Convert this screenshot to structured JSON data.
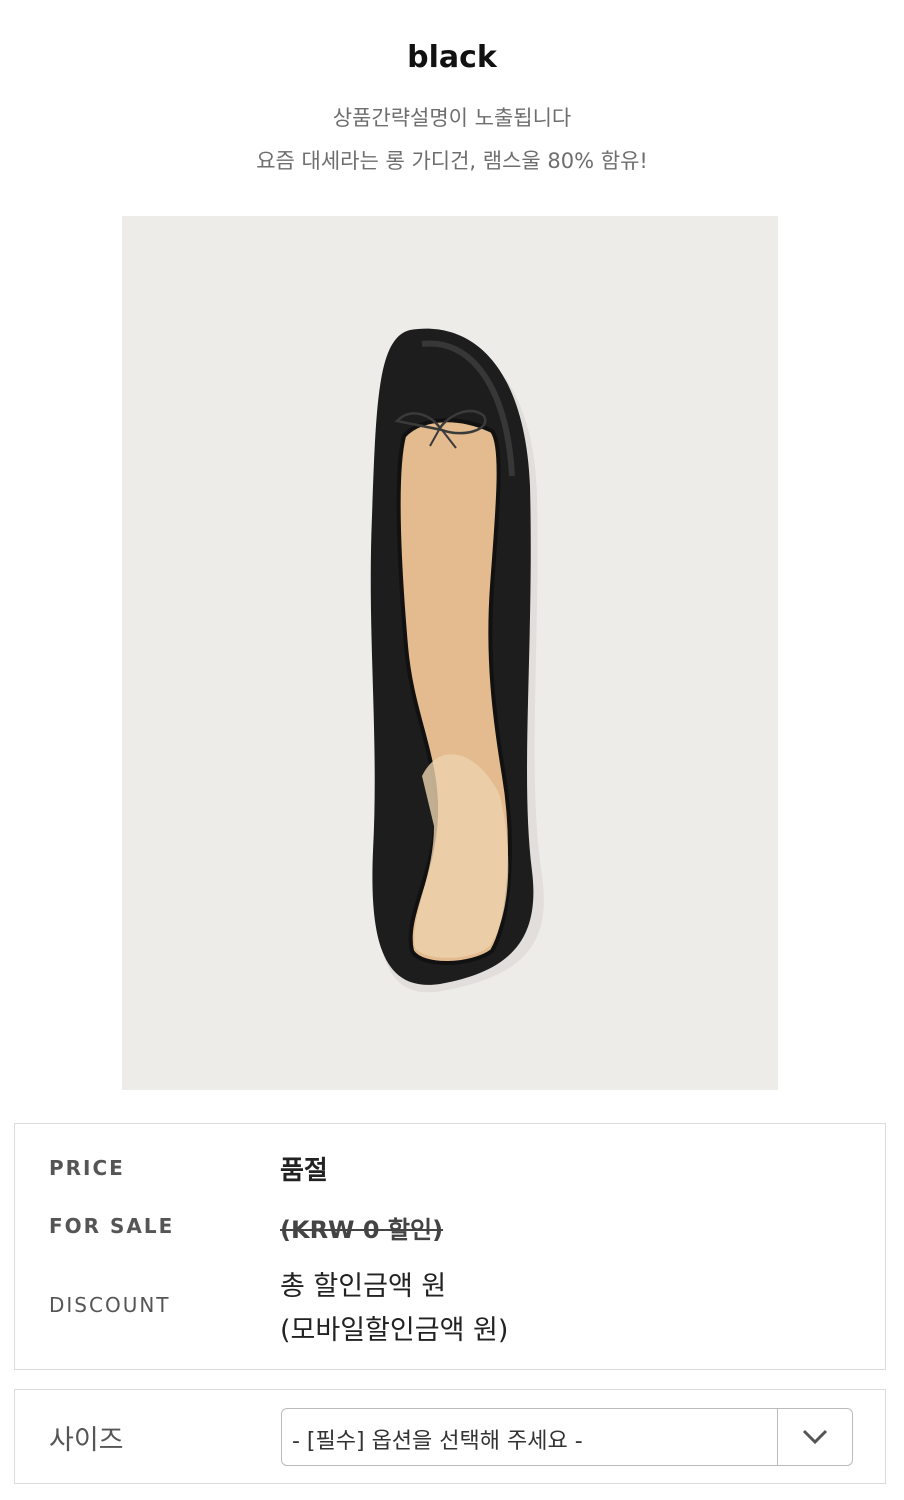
{
  "product": {
    "name": "black",
    "description_line1": "상품간략설명이 노출됩니다",
    "description_line2": "요즘 대세라는 롱 가디건, 램스울 80% 함유!",
    "image_icon": "ballet-flat-shoe-photo"
  },
  "info": {
    "price_label": "PRICE",
    "price_value": "품절",
    "sale_label": "FOR SALE",
    "sale_value": "(KRW 0 할인)",
    "discount_label": "DISCOUNT",
    "discount_total": "총 할인금액 원",
    "discount_mobile": "(모바일할인금액 원)"
  },
  "option": {
    "label": "사이즈",
    "selected": "- [필수] 옵션을 선택해 주세요 -",
    "dropdown_icon": "chevron-down-icon"
  }
}
